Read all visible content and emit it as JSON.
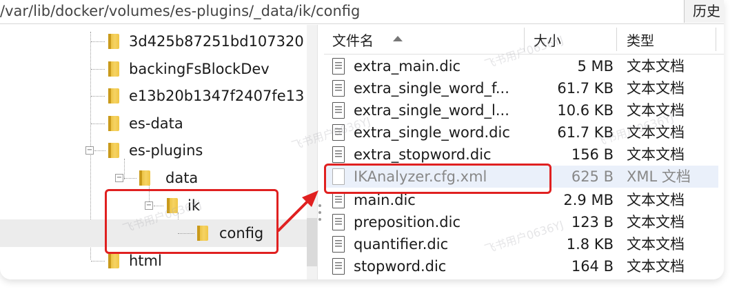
{
  "address_bar": {
    "path": "/var/lib/docker/volumes/es-plugins/_data/ik/config",
    "history_label": "历史"
  },
  "tree": {
    "items": [
      {
        "label": "3d425b87251bd107320"
      },
      {
        "label": "backingFsBlockDev"
      },
      {
        "label": "e13b20b1347f2407fe13"
      },
      {
        "label": "es-data"
      },
      {
        "label": "es-plugins",
        "expander": "−"
      },
      {
        "label": "data",
        "expander": "−"
      },
      {
        "label": "ik",
        "expander": "−"
      },
      {
        "label": "config"
      },
      {
        "label": "html"
      }
    ]
  },
  "file_list": {
    "columns": {
      "name": "文件名",
      "size": "大小",
      "type": "类型"
    },
    "rows": [
      {
        "name": "extra_main.dic",
        "size": "5 MB",
        "type": "文本文档",
        "icon": "text-file-icon"
      },
      {
        "name": "extra_single_word_f...",
        "size": "61.7 KB",
        "type": "文本文档",
        "icon": "text-file-icon"
      },
      {
        "name": "extra_single_word_l...",
        "size": "10.6 KB",
        "type": "文本文档",
        "icon": "text-file-icon"
      },
      {
        "name": "extra_single_word.dic",
        "size": "61.7 KB",
        "type": "文本文档",
        "icon": "text-file-icon"
      },
      {
        "name": "extra_stopword.dic",
        "size": "156 B",
        "type": "文本文档",
        "icon": "text-file-icon"
      },
      {
        "name": "IKAnalyzer.cfg.xml",
        "size": "625 B",
        "type": "XML 文档",
        "icon": "xml-file-icon"
      },
      {
        "name": "main.dic",
        "size": "2.9 MB",
        "type": "文本文档",
        "icon": "text-file-icon"
      },
      {
        "name": "preposition.dic",
        "size": "123 B",
        "type": "文本文档",
        "icon": "text-file-icon"
      },
      {
        "name": "quantifier.dic",
        "size": "1.8 KB",
        "type": "文本文档",
        "icon": "text-file-icon"
      },
      {
        "name": "stopword.dic",
        "size": "164 B",
        "type": "文本文档",
        "icon": "text-file-icon"
      }
    ]
  },
  "watermark": {
    "text": "飞书用户0636YJ"
  },
  "colors": {
    "annotation": "#e02020",
    "folder": "#f0c646",
    "highlight_row": "#eaf0fa"
  }
}
